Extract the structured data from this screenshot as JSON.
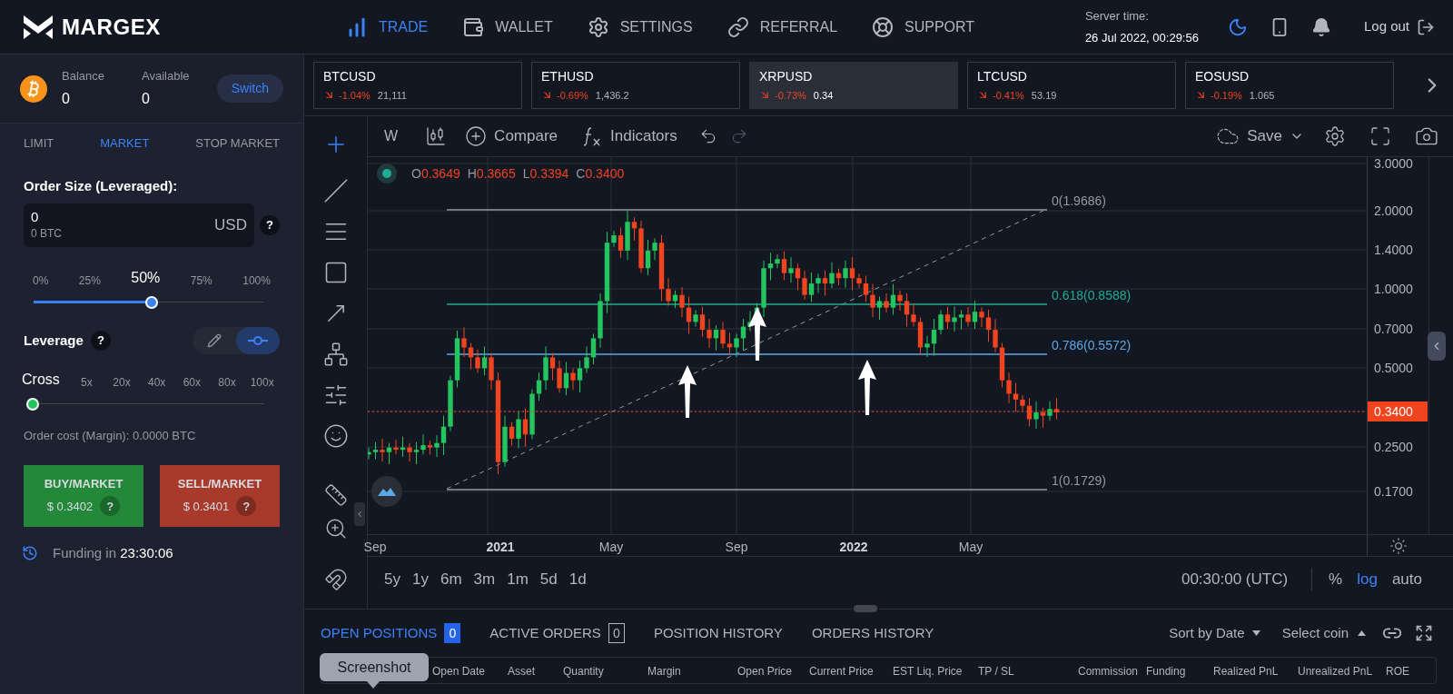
{
  "brand": {
    "name": "MARGEX"
  },
  "nav": [
    {
      "label": "TRADE",
      "kind": "trade",
      "selected": true
    },
    {
      "label": "WALLET",
      "kind": "wallet",
      "selected": false
    },
    {
      "label": "SETTINGS",
      "kind": "settings",
      "selected": false
    },
    {
      "label": "REFERRAL",
      "kind": "referral",
      "selected": false
    },
    {
      "label": "SUPPORT",
      "kind": "support",
      "selected": false
    }
  ],
  "server_time": {
    "label": "Server time:",
    "value": "26 Jul 2022, 00:29:56"
  },
  "logout": "Log out",
  "account": {
    "balance_label": "Balance",
    "balance": "0",
    "available_label": "Available",
    "available": "0",
    "switch": "Switch"
  },
  "order_tabs": [
    {
      "label": "LIMIT",
      "selected": false
    },
    {
      "label": "MARKET",
      "selected": true
    },
    {
      "label": "STOP MARKET",
      "selected": false
    }
  ],
  "order_size": {
    "label": "Order Size (Leveraged):",
    "value": "0",
    "sub_value": "0 BTC",
    "currency": "USD",
    "help": "?"
  },
  "size_slider": {
    "level": 0.5,
    "marks": [
      {
        "label": "0%",
        "selected": false
      },
      {
        "label": "25%",
        "selected": false
      },
      {
        "label": "50%",
        "selected": true
      },
      {
        "label": "75%",
        "selected": false
      },
      {
        "label": "100%",
        "selected": false
      }
    ]
  },
  "leverage": {
    "label": "Leverage",
    "help": "?",
    "level": 0,
    "modes": [
      {
        "kind": "pencil",
        "selected": false
      },
      {
        "kind": "slider",
        "selected": true
      }
    ],
    "marks": [
      {
        "label": "Cross",
        "selected": true
      },
      {
        "label": "5x",
        "selected": false
      },
      {
        "label": "20x",
        "selected": false
      },
      {
        "label": "40x",
        "selected": false
      },
      {
        "label": "60x",
        "selected": false
      },
      {
        "label": "80x",
        "selected": false
      },
      {
        "label": "100x",
        "selected": false
      }
    ]
  },
  "order_cost": "Order cost (Margin): 0.0000 BTC",
  "buy": {
    "label": "BUY/MARKET",
    "price": "$ 0.3402",
    "help": "?"
  },
  "sell": {
    "label": "SELL/MARKET",
    "price": "$ 0.3401",
    "help": "?"
  },
  "funding": {
    "label": "Funding in",
    "value": "23:30:06"
  },
  "tickers": [
    {
      "symbol": "BTCUSD",
      "change": "-1.04%",
      "price": "21,111",
      "selected": false
    },
    {
      "symbol": "ETHUSD",
      "change": "-0.69%",
      "price": "1,436.2",
      "selected": false
    },
    {
      "symbol": "XRPUSD",
      "change": "-0.73%",
      "price": "0.34",
      "selected": true
    },
    {
      "symbol": "LTCUSD",
      "change": "-0.41%",
      "price": "53.19",
      "selected": false
    },
    {
      "symbol": "EOSUSD",
      "change": "-0.19%",
      "price": "1.065",
      "selected": false
    }
  ],
  "chart": {
    "interval": "W",
    "compare": "Compare",
    "indicators": "Indicators",
    "save": "Save",
    "ohlc": [
      {
        "label": "O",
        "value": "0.3649"
      },
      {
        "label": "H",
        "value": "0.3665"
      },
      {
        "label": "L",
        "value": "0.3394"
      },
      {
        "label": "C",
        "value": "0.3400"
      }
    ],
    "fib_levels": [
      {
        "label": "0(1.9686)",
        "color": "#9598a1"
      },
      {
        "label": "0.618(0.8588)",
        "color": "#22ab94"
      },
      {
        "label": "0.786(0.5572)",
        "color": "#5aa9e6"
      },
      {
        "label": "1(0.1729)",
        "color": "#9598a1"
      }
    ],
    "price_ticks": [
      "3.0000",
      "2.0000",
      "1.4000",
      "1.0000",
      "0.7000",
      "0.5000",
      "0.2500",
      "0.1700"
    ],
    "last_price": "0.3400",
    "time_ticks": [
      {
        "label": "Sep",
        "bold": false
      },
      {
        "label": "2021",
        "bold": true
      },
      {
        "label": "May",
        "bold": false
      },
      {
        "label": "Sep",
        "bold": false
      },
      {
        "label": "2022",
        "bold": true
      },
      {
        "label": "May",
        "bold": false
      }
    ],
    "ranges": [
      "5y",
      "1y",
      "6m",
      "3m",
      "1m",
      "5d",
      "1d"
    ],
    "time_zone": "00:30:00 (UTC)",
    "scales": [
      {
        "label": "%",
        "selected": false
      },
      {
        "label": "log",
        "selected": true
      },
      {
        "label": "auto",
        "selected": false
      }
    ]
  },
  "bottom": {
    "tabs": [
      {
        "label": "OPEN POSITIONS",
        "count": "0",
        "selected": true
      },
      {
        "label": "ACTIVE ORDERS",
        "count": "0",
        "selected": false
      },
      {
        "label": "POSITION HISTORY",
        "selected": false
      },
      {
        "label": "ORDERS HISTORY",
        "selected": false
      }
    ],
    "sort": "Sort by Date",
    "coin": "Select coin",
    "tooltip": "Screenshot",
    "columns": [
      "Open Date",
      "Asset",
      "Quantity",
      "Margin",
      "Open Price",
      "Current Price",
      "EST Liq. Price",
      "TP / SL",
      "Commission",
      "Funding",
      "Realized PnL",
      "Unrealized PnL",
      "ROE"
    ]
  }
}
